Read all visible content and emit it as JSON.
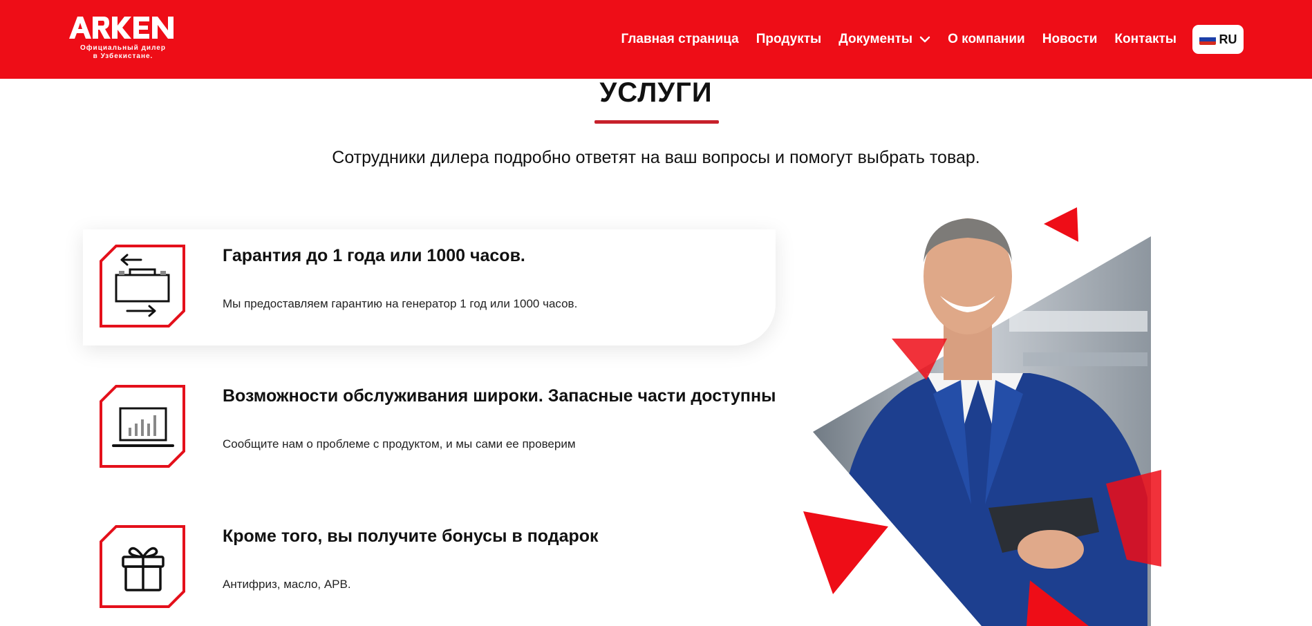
{
  "brand": {
    "logo_text": "ARKEN",
    "tagline_line1": "Официальный дилер",
    "tagline_line2": "в Узбекистане.",
    "accent_color": "#ee0d17"
  },
  "nav": {
    "items": [
      {
        "label": "Главная страница"
      },
      {
        "label": "Продукты"
      },
      {
        "label": "Документы"
      },
      {
        "label": "О компании"
      },
      {
        "label": "Новости"
      },
      {
        "label": "Контакты"
      }
    ],
    "language": "RU"
  },
  "section": {
    "title": "УСЛУГИ",
    "subtitle": "Сотрудники дилера подробно ответят на ваш вопросы и помогут выбрать товар."
  },
  "services": [
    {
      "title": "Гарантия до 1 года или 1000 часов.",
      "description": "Мы предоставляем гарантию на генератор 1 год или 1000 часов.",
      "icon": "generator-icon"
    },
    {
      "title": "Возможности обслуживания широки. Запасные части доступны",
      "description": "Сообщите нам о проблеме с продуктом, и мы сами ее проверим",
      "icon": "laptop-chart-icon"
    },
    {
      "title": "Кроме того, вы получите бонусы в подарок",
      "description": "Антифриз, масло, АРВ.",
      "icon": "gift-icon"
    }
  ]
}
